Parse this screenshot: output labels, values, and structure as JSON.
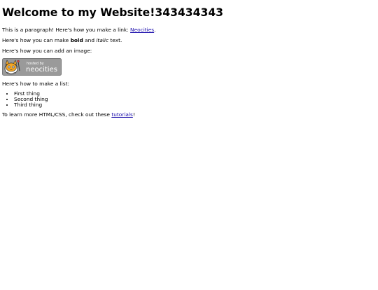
{
  "page": {
    "heading": "Welcome to my Website!343434343",
    "intro": {
      "before": "This is a paragraph! Here's how you make a link: ",
      "link": "Neocities",
      "after": "."
    },
    "formatting": {
      "before": "Here's how you can make ",
      "bold": "bold",
      "middle": " and ",
      "italic": "italic",
      "after": " text."
    },
    "image_text": "Here's how you can add an image:",
    "badge": {
      "small": "hosted by",
      "name": "neocities"
    },
    "list_text": "Here's how to make a list:",
    "list_items": [
      "First thing",
      "Second thing",
      "Third thing"
    ],
    "learn": {
      "before": "To learn more HTML/CSS, check out these ",
      "link": "tutorials",
      "after": "!"
    }
  },
  "colors": {
    "link": "#1a0dab",
    "badge_bg": "#999999",
    "badge_text": "#ffffff",
    "cat_orange": "#f5a623"
  }
}
